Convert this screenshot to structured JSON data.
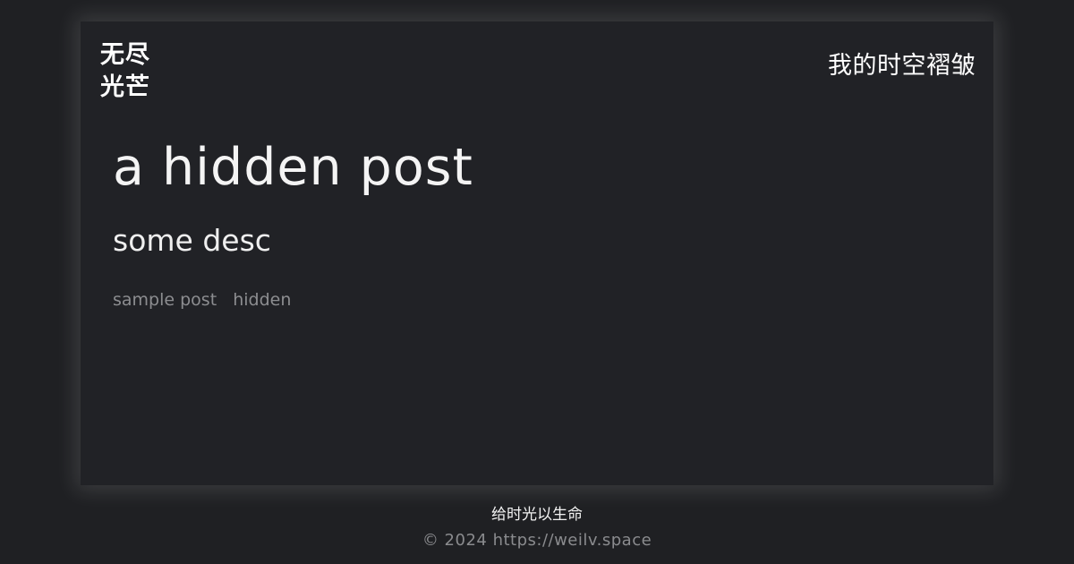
{
  "header": {
    "logo_line1": "无尽",
    "logo_line2": "光芒",
    "site_title": "我的时空褶皱"
  },
  "post": {
    "title": "a hidden post",
    "description": "some desc",
    "tags": [
      "sample post",
      "hidden"
    ]
  },
  "footer": {
    "motto": "给时光以生命",
    "copyright": "© 2024 https://weilv.space"
  },
  "colors": {
    "background": "#1f2023",
    "card": "#212226",
    "text": "#ffffff",
    "muted": "#8c8d90"
  }
}
